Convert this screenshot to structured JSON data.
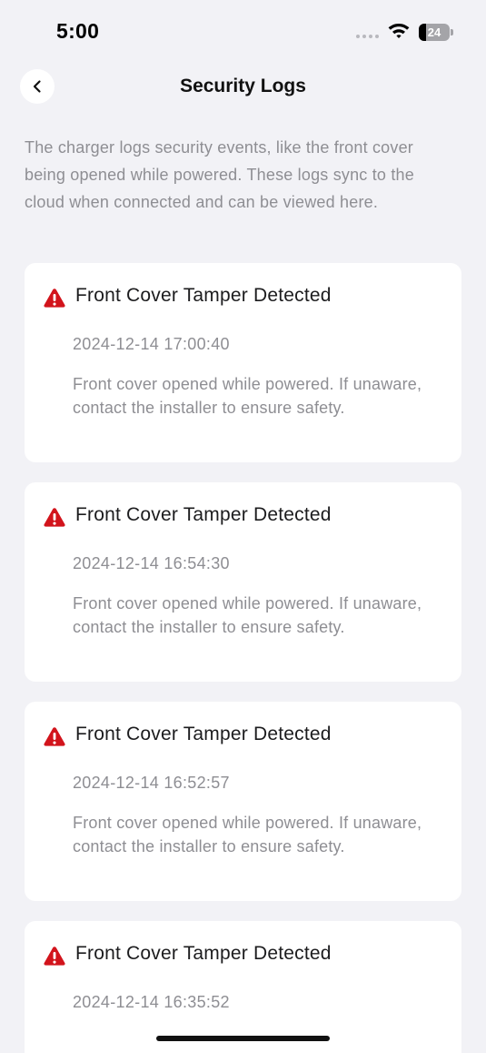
{
  "status_bar": {
    "time": "5:00",
    "battery_level": "24",
    "battery_fraction": 0.24,
    "icons": [
      "signal-dots-icon",
      "wifi-icon",
      "battery-icon"
    ]
  },
  "nav": {
    "back_icon": "chevron-left-icon",
    "title": "Security Logs"
  },
  "intro": "The charger logs security events, like the front cover being opened while powered. These logs sync to the cloud when connected and can be viewed here.",
  "colors": {
    "background": "#f2f2f6",
    "card": "#ffffff",
    "warning_red": "#d2141c",
    "secondary_text": "#8e8e93"
  },
  "logs": [
    {
      "icon": "warning-triangle-icon",
      "title": "Front Cover Tamper Detected",
      "timestamp": "2024-12-14 17:00:40",
      "description": "Front cover opened while powered. If unaware, contact the installer to ensure safety."
    },
    {
      "icon": "warning-triangle-icon",
      "title": "Front Cover Tamper Detected",
      "timestamp": "2024-12-14 16:54:30",
      "description": "Front cover opened while powered. If unaware, contact the installer to ensure safety."
    },
    {
      "icon": "warning-triangle-icon",
      "title": "Front Cover Tamper Detected",
      "timestamp": "2024-12-14 16:52:57",
      "description": "Front cover opened while powered. If unaware, contact the installer to ensure safety."
    },
    {
      "icon": "warning-triangle-icon",
      "title": "Front Cover Tamper Detected",
      "timestamp": "2024-12-14 16:35:52"
    }
  ]
}
